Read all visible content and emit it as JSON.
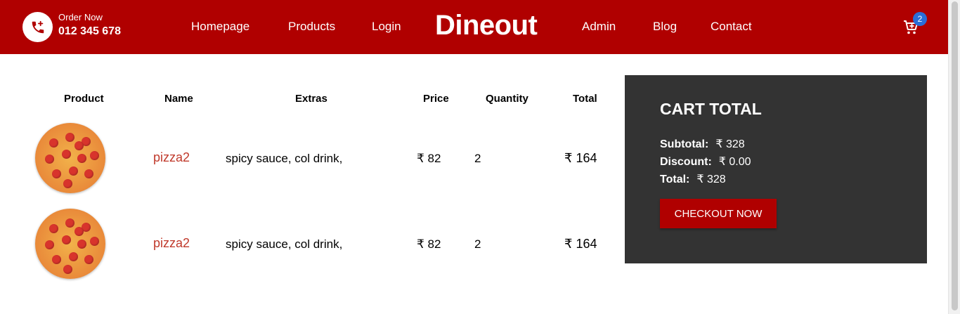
{
  "header": {
    "order_label": "Order Now",
    "phone": "012 345 678",
    "brand": "Dineout",
    "nav_left": [
      "Homepage",
      "Products",
      "Login"
    ],
    "nav_right": [
      "Admin",
      "Blog",
      "Contact"
    ],
    "cart_count": "2",
    "icons": {
      "phone": "phone-plus-icon",
      "cart": "cart-plus-icon"
    }
  },
  "table": {
    "headers": [
      "Product",
      "Name",
      "Extras",
      "Price",
      "Quantity",
      "Total"
    ],
    "rows": [
      {
        "image": "pizza-image",
        "name": "pizza2",
        "extras": "spicy sauce, col drink,",
        "price": "₹ 82",
        "quantity": "2",
        "total": "₹ 164"
      },
      {
        "image": "pizza-image",
        "name": "pizza2",
        "extras": "spicy sauce, col drink,",
        "price": "₹ 82",
        "quantity": "2",
        "total": "₹ 164"
      }
    ]
  },
  "cart_total": {
    "title": "CART TOTAL",
    "subtotal_label": "Subtotal:",
    "subtotal": "₹ 328",
    "discount_label": "Discount:",
    "discount": "₹ 0.00",
    "total_label": "Total:",
    "total": "₹ 328",
    "checkout_label": "CHECKOUT NOW"
  },
  "colors": {
    "brand_red": "#b00000",
    "panel_dark": "#333333",
    "name_link": "#c0392b",
    "badge_blue": "#2a6ed8"
  }
}
